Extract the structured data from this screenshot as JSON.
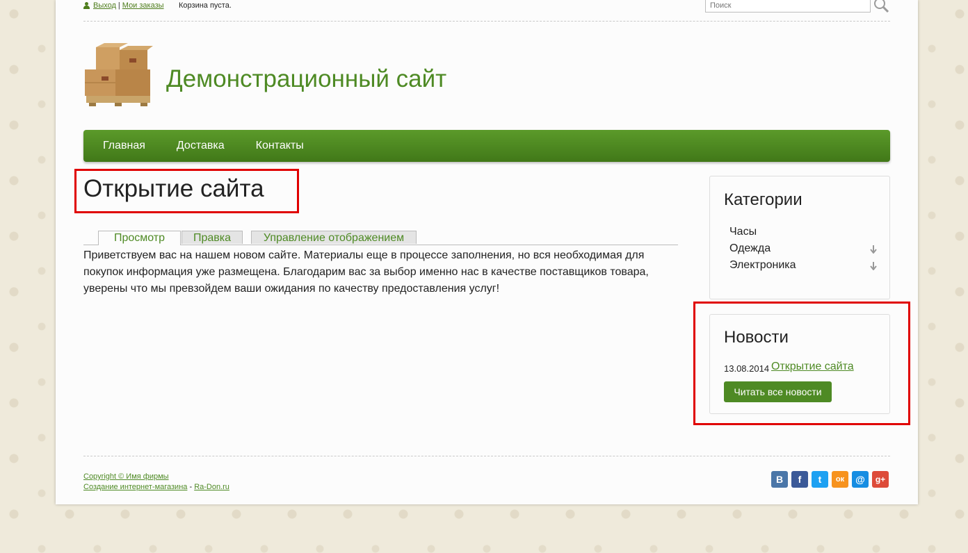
{
  "topbar": {
    "logout": "Выход",
    "separator": "|",
    "orders": "Мои заказы",
    "cart": "Корзина пуста.",
    "search_placeholder": "Поиск"
  },
  "header": {
    "site_title": "Демонстрационный сайт"
  },
  "nav": [
    {
      "label": "Главная"
    },
    {
      "label": "Доставка"
    },
    {
      "label": "Контакты"
    }
  ],
  "main": {
    "title": "Открытие сайта",
    "tabs": [
      {
        "label": "Просмотр"
      },
      {
        "label": "Правка"
      },
      {
        "label": "Управление отображением"
      }
    ],
    "body": "Приветствуем вас на нашем новом сайте. Материалы еще в процессе заполнения, но вся необходимая для покупок информация уже размещена. Благодарим вас за выбор именно нас в качестве поставщиков товара, уверены что мы превзойдем ваши ожидания по качеству предоставления услуг!"
  },
  "categories": {
    "title": "Категории",
    "items": [
      {
        "label": "Часы"
      },
      {
        "label": "Одежда"
      },
      {
        "label": "Электроника"
      }
    ]
  },
  "news": {
    "title": "Новости",
    "date": "13.08.2014",
    "link": "Открытие сайта",
    "button": "Читать все новости"
  },
  "footer": {
    "copyright": "Copyright © Имя фирмы",
    "created": "Создание интернет-магазина",
    "dash": " - ",
    "radon": "Ra-Don.ru"
  },
  "social": [
    {
      "name": "vk-icon",
      "glyph": "В",
      "color": "#4a76a8"
    },
    {
      "name": "facebook-icon",
      "glyph": "f",
      "color": "#3b5998"
    },
    {
      "name": "twitter-icon",
      "glyph": "t",
      "color": "#1da1f2"
    },
    {
      "name": "odnoklassniki-icon",
      "glyph": "ок",
      "color": "#f7931e"
    },
    {
      "name": "mailru-icon",
      "glyph": "@",
      "color": "#168de2"
    },
    {
      "name": "googleplus-icon",
      "glyph": "g+",
      "color": "#dd4b39"
    }
  ]
}
